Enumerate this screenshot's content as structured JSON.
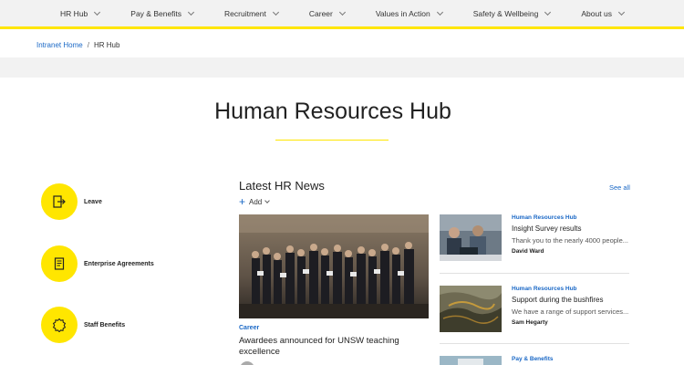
{
  "nav": {
    "items": [
      {
        "label": "HR Hub"
      },
      {
        "label": "Pay & Benefits"
      },
      {
        "label": "Recruitment"
      },
      {
        "label": "Career"
      },
      {
        "label": "Values in Action"
      },
      {
        "label": "Safety & Wellbeing"
      },
      {
        "label": "About us"
      }
    ]
  },
  "breadcrumb": {
    "home": "Intranet Home",
    "separator": "/",
    "current": "HR Hub"
  },
  "page": {
    "title": "Human Resources Hub"
  },
  "quick_links": [
    {
      "label": "Leave",
      "icon": "exit-door-icon"
    },
    {
      "label": "Enterprise Agreements",
      "icon": "scroll-document-icon"
    },
    {
      "label": "Staff Benefits",
      "icon": "badge-star-icon"
    }
  ],
  "news": {
    "heading": "Latest HR News",
    "add_label": "Add",
    "see_all": "See all",
    "feature": {
      "category": "Career",
      "title": "Awardees announced for UNSW teaching excellence"
    },
    "side": [
      {
        "category": "Human Resources Hub",
        "title": "Insight Survey results",
        "desc": "Thank you to the nearly 4000 people...",
        "author": "David Ward"
      },
      {
        "category": "Human Resources Hub",
        "title": "Support during the bushfires",
        "desc": "We have a range of support services...",
        "author": "Sam Hegarty"
      },
      {
        "category": "Pay & Benefits",
        "title": "",
        "desc": "",
        "author": ""
      }
    ]
  },
  "colors": {
    "accent": "#ffe600",
    "link": "#1a68c6",
    "nav_bg": "#f2f2f2"
  }
}
